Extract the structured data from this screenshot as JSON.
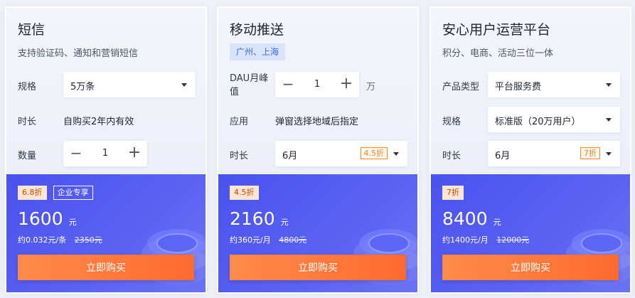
{
  "cards": [
    {
      "title": "短信",
      "subtitle": "支持验证码、通知和营销短信",
      "spec_label": "规格",
      "spec_value": "5万条",
      "duration_label": "时长",
      "duration_text": "自购买2年内有效",
      "qty_label": "数量",
      "qty_value": "1",
      "discount_tag": "6.8折",
      "extra_tag": "企业专享",
      "price": "1600",
      "currency": "元",
      "approx": "约0.032元/条",
      "original_price": "2350元",
      "buy_label": "立即购买"
    },
    {
      "title": "移动推送",
      "region_chip": "广州、上海",
      "dau_label": "DAU月峰值",
      "dau_value": "1",
      "dau_unit": "万",
      "usage_label": "应用",
      "usage_text": "弹窗选择地域后指定",
      "duration_label": "时长",
      "duration_value": "6月",
      "duration_discount": "4.5折",
      "discount_tag": "4.5折",
      "price": "2160",
      "currency": "元",
      "approx": "约360元/月",
      "original_price": "4800元",
      "buy_label": "立即购买"
    },
    {
      "title": "安心用户运营平台",
      "subtitle": "积分、电商、活动三位一体",
      "type_label": "产品类型",
      "type_value": "平台服务费",
      "spec_label": "规格",
      "spec_value": "标准版（20万用户）",
      "duration_label": "时长",
      "duration_value": "6月",
      "duration_discount": "7折",
      "discount_tag": "7折",
      "price": "8400",
      "currency": "元",
      "approx": "约1400元/月",
      "original_price": "12000元",
      "buy_label": "立即购买"
    }
  ],
  "icons": {
    "minus": "−",
    "plus": "+",
    "caret": "chevron-down-icon"
  },
  "colors": {
    "accent_blue": "#4b52ee",
    "buy_orange": "#ff6a2e",
    "chip_blue": "#3f6ad8",
    "discount_orange": "#f08a24"
  }
}
